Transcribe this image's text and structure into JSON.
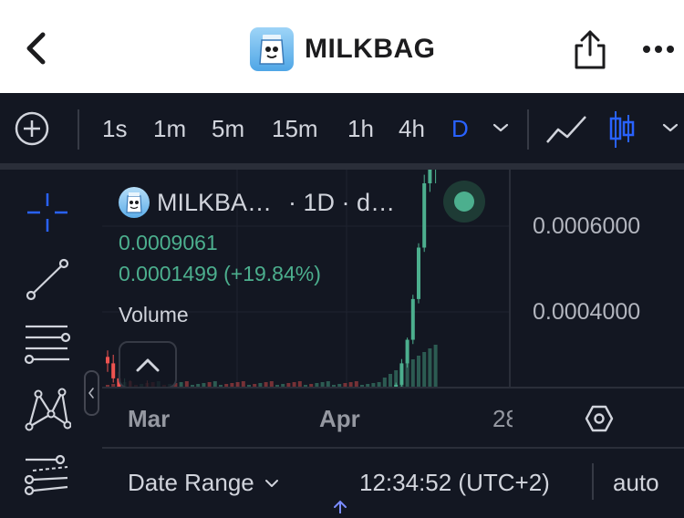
{
  "header": {
    "title": "MILKBAG",
    "back_icon": "chevron-left-icon",
    "share_icon": "share-icon",
    "more_icon": "ellipsis-icon"
  },
  "toolbar": {
    "intervals": [
      "1s",
      "1m",
      "5m",
      "15m",
      "1h",
      "4h",
      "D"
    ],
    "active_interval": "D",
    "active_color": "#2962ff"
  },
  "legend": {
    "symbol": "MILKBA…",
    "interval": "· 1D · d…",
    "price": "0.0009061",
    "change": "0.0001499 (+19.84%)",
    "volume_label": "Volume",
    "up_color": "#4caf8e",
    "down_color": "#ef5350"
  },
  "price_axis": {
    "labels": [
      "0.0006000",
      "0.0004000"
    ]
  },
  "time_axis": {
    "labels": [
      "Mar",
      "Apr",
      "28"
    ]
  },
  "bottom": {
    "date_range_label": "Date Range",
    "clock": "12:34:52 (UTC+2)",
    "auto_label": "auto"
  }
}
